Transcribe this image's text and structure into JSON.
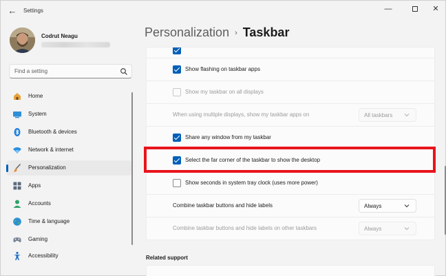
{
  "window": {
    "title": "Settings",
    "back_icon": "back-arrow-icon",
    "controls": [
      "minimize-icon",
      "maximize-icon",
      "close-icon"
    ]
  },
  "profile": {
    "name": "Codrut Neagu"
  },
  "search": {
    "placeholder": "Find a setting",
    "icon": "search-icon"
  },
  "nav": {
    "items": [
      {
        "label": "Home",
        "icon": "home-icon"
      },
      {
        "label": "System",
        "icon": "system-icon"
      },
      {
        "label": "Bluetooth & devices",
        "icon": "bluetooth-icon"
      },
      {
        "label": "Network & internet",
        "icon": "wifi-icon"
      },
      {
        "label": "Personalization",
        "icon": "brush-icon",
        "active": true
      },
      {
        "label": "Apps",
        "icon": "apps-icon"
      },
      {
        "label": "Accounts",
        "icon": "accounts-icon"
      },
      {
        "label": "Time & language",
        "icon": "globe-icon"
      },
      {
        "label": "Gaming",
        "icon": "gaming-icon"
      },
      {
        "label": "Accessibility",
        "icon": "accessibility-icon"
      }
    ]
  },
  "breadcrumb": {
    "parent": "Personalization",
    "separator": "›",
    "current": "Taskbar"
  },
  "settings": {
    "show_flashing": {
      "label": "Show flashing on taskbar apps",
      "checked": true
    },
    "show_all_displays": {
      "label": "Show my taskbar on all displays",
      "checked": false,
      "disabled": true
    },
    "multiple_displays": {
      "label": "When using multiple displays, show my taskbar apps on",
      "value": "All taskbars",
      "disabled": true
    },
    "share_window": {
      "label": "Share any window from my taskbar",
      "checked": true
    },
    "far_corner": {
      "label": "Select the far corner of the taskbar to show the desktop",
      "checked": true
    },
    "show_seconds": {
      "label": "Show seconds in system tray clock (uses more power)",
      "checked": false
    },
    "combine": {
      "label": "Combine taskbar buttons and hide labels",
      "value": "Always"
    },
    "combine_other": {
      "label": "Combine taskbar buttons and hide labels on other taskbars",
      "value": "Always",
      "disabled": true
    }
  },
  "related": {
    "heading": "Related support"
  },
  "colors": {
    "accent": "#005fb8",
    "highlight": "#e8141c"
  }
}
